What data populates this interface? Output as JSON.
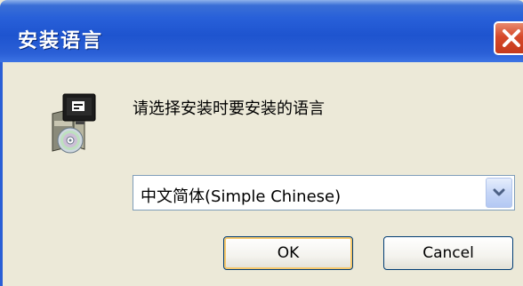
{
  "window": {
    "title": "安装语言",
    "close_icon": "close-icon"
  },
  "content": {
    "icon": "setup-installer-icon",
    "prompt": "请选择安装时要安装的语言",
    "language_select": {
      "selected": "中文简体(Simple Chinese)",
      "dropdown_icon": "chevron-down-icon"
    }
  },
  "buttons": {
    "ok_label": "OK",
    "cancel_label": "Cancel"
  },
  "colors": {
    "titlebar": "#2860d9",
    "dialog_bg": "#ece9d8",
    "close_button": "#d6492a",
    "select_border": "#7f9db9",
    "button_border": "#003c74"
  }
}
